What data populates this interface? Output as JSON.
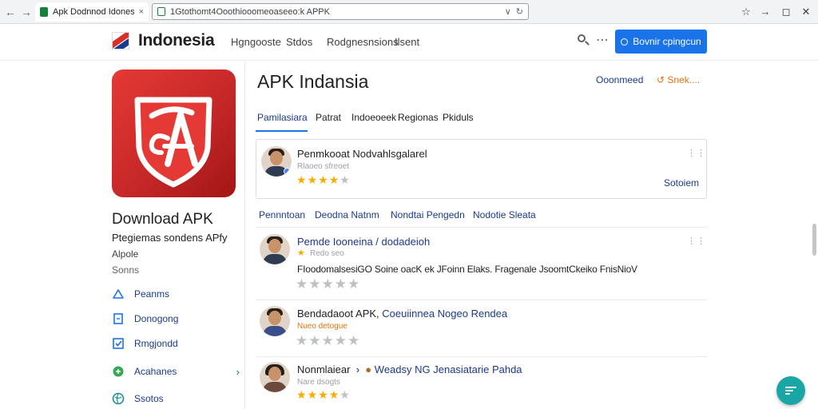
{
  "browser": {
    "tab_title": "Apk Dodnnod Idonesa",
    "tab_close": "×",
    "address": "1Gtothomt4Ooothiooomeoaseeo:k APPK",
    "address_icons": [
      "chevron-down-icon",
      "reload-icon"
    ],
    "toolbar_icons": [
      "star-icon",
      "forward-icon",
      "restore-icon",
      "close-icon"
    ]
  },
  "header": {
    "brand": "Indonesia",
    "nav": [
      "Hgngooste",
      "Stdos",
      "Rodgnesnsions",
      "Ilsent"
    ],
    "cta_label": "Bovnir cpingcun"
  },
  "sidebar": {
    "title": "Download APK",
    "subtitle": "Ptegiemas sondens APfy",
    "line2": "Alpole",
    "line3": "Sonns",
    "items": [
      {
        "label": "Peanms",
        "icon": "triangle-icon"
      },
      {
        "label": "Donogong",
        "icon": "document-icon"
      },
      {
        "label": "Rmgjondd",
        "icon": "checkbox-icon"
      },
      {
        "label": "Acahanes",
        "icon": "plus-circle-icon"
      },
      {
        "label": "Ssotos",
        "icon": "globe-icon"
      }
    ]
  },
  "main": {
    "title": "APK Indansia",
    "actions": [
      "Ooonmeed",
      "Snek...."
    ],
    "tabs": [
      "Pamilasiara",
      "Patrat",
      "Indoeoeek",
      "Regionas",
      "Pkiduls"
    ],
    "featured": {
      "title": "Penmkooat Nodvahlsgalarel",
      "meta": "Rlaoeo sfreoet",
      "stars": 4,
      "action": "Sotoiem"
    },
    "filters": [
      "Pennntoan",
      "Deodna Natnm",
      "Nondtai Pengedn",
      "Nodotie Sleata"
    ],
    "reviews": [
      {
        "title": "Pemde Iooneina / dodadeioh",
        "title_extra": "",
        "meta": "Redo seo",
        "text": "FIoodomalsesiGO Soine oacK ek JFoinn Elaks. Fragenale JsoomtCkeiko FnisNioV",
        "stars": 0
      },
      {
        "title": "Bendadaoot APK,",
        "title_extra": "Coeuiinnea Nogeo Rendea",
        "meta": "Nueo detogue",
        "text": "",
        "stars": 0
      },
      {
        "title": "Nonmlaiear",
        "title_extra": "Weadsy NG Jenasiatarie Pahda",
        "meta": "Nare dsogts",
        "text": "",
        "stars": 3.5
      }
    ]
  }
}
